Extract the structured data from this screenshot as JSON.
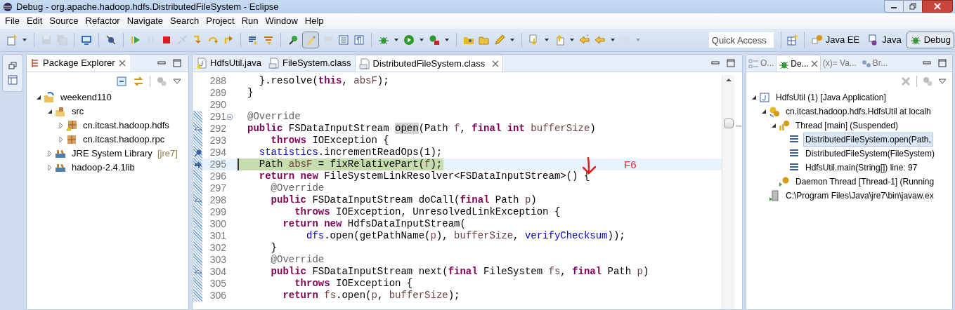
{
  "window": {
    "title": "Debug - org.apache.hadoop.hdfs.DistributedFileSystem - Eclipse"
  },
  "menu": [
    "File",
    "Edit",
    "Source",
    "Refactor",
    "Navigate",
    "Search",
    "Project",
    "Run",
    "Window",
    "Help"
  ],
  "toolbar": [
    {
      "kind": "new",
      "pressed": false,
      "disabled": false
    },
    {
      "kind": "caret",
      "pressed": false,
      "disabled": false
    },
    {
      "kind": "separator"
    },
    {
      "kind": "save",
      "pressed": false,
      "disabled": true
    },
    {
      "kind": "save-all",
      "pressed": false,
      "disabled": true
    },
    {
      "kind": "separator"
    },
    {
      "kind": "console",
      "pressed": false,
      "disabled": false
    },
    {
      "kind": "separator"
    },
    {
      "kind": "skip-breakpoints",
      "pressed": false,
      "disabled": false
    },
    {
      "kind": "separator"
    },
    {
      "kind": "resume",
      "pressed": false,
      "disabled": false
    },
    {
      "kind": "suspend",
      "pressed": false,
      "disabled": true
    },
    {
      "kind": "terminate",
      "pressed": false,
      "disabled": false
    },
    {
      "kind": "disconnect",
      "pressed": false,
      "disabled": true
    },
    {
      "kind": "step-into",
      "pressed": false,
      "disabled": false
    },
    {
      "kind": "step-over",
      "pressed": false,
      "disabled": false
    },
    {
      "kind": "step-return",
      "pressed": false,
      "disabled": false
    },
    {
      "kind": "separator"
    },
    {
      "kind": "drop-frame",
      "pressed": false,
      "disabled": false
    },
    {
      "kind": "step-filters",
      "pressed": false,
      "disabled": false
    },
    {
      "kind": "separator"
    },
    {
      "kind": "breakpoint-toggle",
      "pressed": false,
      "disabled": false
    },
    {
      "kind": "highlight",
      "pressed": true,
      "disabled": false
    },
    {
      "kind": "comment",
      "pressed": false,
      "disabled": true
    },
    {
      "kind": "block",
      "pressed": false,
      "disabled": false
    },
    {
      "kind": "whitespace",
      "pressed": false,
      "disabled": false
    },
    {
      "kind": "separator"
    },
    {
      "kind": "debug",
      "pressed": false,
      "disabled": false
    },
    {
      "kind": "caret",
      "pressed": false,
      "disabled": false
    },
    {
      "kind": "run",
      "pressed": false,
      "disabled": false
    },
    {
      "kind": "caret",
      "pressed": false,
      "disabled": false
    },
    {
      "kind": "external-tools",
      "pressed": false,
      "disabled": false
    },
    {
      "kind": "caret",
      "pressed": false,
      "disabled": false
    },
    {
      "kind": "separator"
    },
    {
      "kind": "open-type",
      "pressed": false,
      "disabled": false
    },
    {
      "kind": "open-folder",
      "pressed": false,
      "disabled": false
    },
    {
      "kind": "pencil",
      "pressed": false,
      "disabled": false
    },
    {
      "kind": "caret",
      "pressed": false,
      "disabled": false
    },
    {
      "kind": "separator"
    },
    {
      "kind": "next-annotation",
      "pressed": false,
      "disabled": false
    },
    {
      "kind": "caret",
      "pressed": false,
      "disabled": false
    },
    {
      "kind": "prev-annotation",
      "pressed": false,
      "disabled": false
    },
    {
      "kind": "caret",
      "pressed": false,
      "disabled": false
    },
    {
      "kind": "back",
      "pressed": false,
      "disabled": false
    },
    {
      "kind": "back-arrow",
      "pressed": false,
      "disabled": false
    },
    {
      "kind": "caret",
      "pressed": false,
      "disabled": false
    },
    {
      "kind": "forward",
      "pressed": false,
      "disabled": true
    },
    {
      "kind": "caret",
      "pressed": false,
      "disabled": true
    }
  ],
  "quick_access": {
    "placeholder": "Quick Access"
  },
  "perspectives": [
    {
      "label": "Java EE",
      "kind": "javaee",
      "selected": false
    },
    {
      "label": "Java",
      "kind": "java",
      "selected": false
    },
    {
      "label": "Debug",
      "kind": "debug",
      "selected": true
    }
  ],
  "package_explorer": {
    "title": "Package Explorer",
    "items": [
      {
        "label": "weekend110",
        "kind": "project",
        "expanded": true,
        "selected": false,
        "children": [
          {
            "label": "src",
            "kind": "source-folder",
            "expanded": true,
            "selected": false,
            "children": [
              {
                "label": "cn.itcast.hadoop.hdfs",
                "kind": "package-warning",
                "expanded": false,
                "selected": false
              },
              {
                "label": "cn.itcast.hadoop.rpc",
                "kind": "package",
                "expanded": false,
                "selected": false
              }
            ]
          },
          {
            "label": "JRE System Library",
            "decoration": "[jre7]",
            "kind": "library",
            "expanded": false,
            "selected": false
          },
          {
            "label": "hadoop-2.4.1lib",
            "kind": "library",
            "expanded": false,
            "selected": false
          }
        ]
      }
    ]
  },
  "editor": {
    "tabs": [
      {
        "label": "HdfsUtil.java",
        "kind": "java",
        "selected": false
      },
      {
        "label": "FileSystem.class",
        "kind": "class",
        "selected": false
      },
      {
        "label": "DistributedFileSystem.class",
        "kind": "class",
        "selected": true
      }
    ],
    "lines": [
      {
        "number": "288",
        "kind": "plain",
        "in_range": false,
        "current": false,
        "tokens": [
          {
            "kind": "plain",
            "text": "  }.resolve("
          },
          {
            "kind": "keyword",
            "text": "this"
          },
          {
            "kind": "plain",
            "text": ", "
          },
          {
            "kind": "local",
            "text": "absF"
          },
          {
            "kind": "plain",
            "text": ");"
          }
        ]
      },
      {
        "number": "289",
        "kind": "plain",
        "in_range": false,
        "current": false,
        "tokens": [
          {
            "kind": "plain",
            "text": "}"
          }
        ]
      },
      {
        "number": "290",
        "kind": "plain",
        "in_range": false,
        "current": false
      },
      {
        "number": "291",
        "in_range": true,
        "current": false,
        "kind": "fold",
        "tokens": [
          {
            "kind": "annotation",
            "text": "@Override"
          }
        ]
      },
      {
        "number": "292",
        "in_range": true,
        "current": false,
        "kind": "override",
        "tokens": [
          {
            "kind": "keyword",
            "text": "public"
          },
          {
            "kind": "plain",
            "text": " FSDataInputStream "
          },
          {
            "kind": "occurrence",
            "text": "open"
          },
          {
            "kind": "plain",
            "text": "(Path "
          },
          {
            "kind": "local",
            "text": "f"
          },
          {
            "kind": "plain",
            "text": ", "
          },
          {
            "kind": "keyword",
            "text": "final int"
          },
          {
            "kind": "local",
            "text": " bufferSize"
          },
          {
            "kind": "plain",
            "text": ")"
          }
        ]
      },
      {
        "number": "293",
        "kind": "plain",
        "in_range": true,
        "current": false,
        "tokens": [
          {
            "kind": "keyword",
            "text": "    throws"
          },
          {
            "kind": "plain",
            "text": " IOException {"
          }
        ]
      },
      {
        "number": "294",
        "in_range": true,
        "current": false,
        "kind": "breakpoint",
        "tokens": [
          {
            "kind": "field",
            "text": "  statistics"
          },
          {
            "kind": "plain",
            "text": ".incrementReadOps(1);"
          }
        ]
      },
      {
        "number": "295",
        "in_range": true,
        "current": true,
        "kind": "instruction-pointer",
        "tokens": [
          {
            "kind": "plain",
            "text": "  Path "
          },
          {
            "kind": "local",
            "text": "absF"
          },
          {
            "kind": "plain",
            "text": " = fixRelativePart("
          },
          {
            "kind": "local",
            "text": "f"
          },
          {
            "kind": "plain",
            "text": ");"
          }
        ]
      },
      {
        "number": "296",
        "kind": "plain",
        "in_range": true,
        "current": false,
        "tokens": [
          {
            "kind": "keyword",
            "text": "  return new"
          },
          {
            "kind": "plain",
            "text": " FileSystemLinkResolver<FSDataInputStream>() {"
          }
        ]
      },
      {
        "number": "297",
        "kind": "plain",
        "in_range": true,
        "current": false,
        "tokens": [
          {
            "kind": "annotation",
            "text": "    @Override"
          }
        ]
      },
      {
        "number": "298",
        "in_range": true,
        "current": false,
        "kind": "override",
        "tokens": [
          {
            "kind": "keyword",
            "text": "    public"
          },
          {
            "kind": "plain",
            "text": " FSDataInputStream doCall("
          },
          {
            "kind": "keyword",
            "text": "final"
          },
          {
            "kind": "plain",
            "text": " Path "
          },
          {
            "kind": "local",
            "text": "p"
          },
          {
            "kind": "plain",
            "text": ")"
          }
        ]
      },
      {
        "number": "299",
        "kind": "plain",
        "in_range": true,
        "current": false,
        "tokens": [
          {
            "kind": "keyword",
            "text": "        throws"
          },
          {
            "kind": "plain",
            "text": " IOException, UnresolvedLinkException {"
          }
        ]
      },
      {
        "number": "300",
        "kind": "plain",
        "in_range": true,
        "current": false,
        "tokens": [
          {
            "kind": "keyword",
            "text": "      return new"
          },
          {
            "kind": "plain",
            "text": " HdfsDataInputStream("
          }
        ]
      },
      {
        "number": "301",
        "kind": "plain",
        "in_range": true,
        "current": false,
        "tokens": [
          {
            "kind": "field",
            "text": "          dfs"
          },
          {
            "kind": "plain",
            "text": ".open(getPathName("
          },
          {
            "kind": "local",
            "text": "p"
          },
          {
            "kind": "plain",
            "text": "), "
          },
          {
            "kind": "local",
            "text": "bufferSize"
          },
          {
            "kind": "plain",
            "text": ", "
          },
          {
            "kind": "field",
            "text": "verifyChecksum"
          },
          {
            "kind": "plain",
            "text": "));"
          }
        ]
      },
      {
        "number": "302",
        "kind": "plain",
        "in_range": true,
        "current": false,
        "tokens": [
          {
            "kind": "plain",
            "text": "    }"
          }
        ]
      },
      {
        "number": "303",
        "kind": "plain",
        "in_range": true,
        "current": false,
        "tokens": [
          {
            "kind": "annotation",
            "text": "    @Override"
          }
        ]
      },
      {
        "number": "304",
        "in_range": true,
        "current": false,
        "kind": "override",
        "tokens": [
          {
            "kind": "keyword",
            "text": "    public"
          },
          {
            "kind": "plain",
            "text": " FSDataInputStream next("
          },
          {
            "kind": "keyword",
            "text": "final"
          },
          {
            "kind": "plain",
            "text": " FileSystem "
          },
          {
            "kind": "local",
            "text": "fs"
          },
          {
            "kind": "plain",
            "text": ", "
          },
          {
            "kind": "keyword",
            "text": "final"
          },
          {
            "kind": "plain",
            "text": " Path "
          },
          {
            "kind": "local",
            "text": "p"
          },
          {
            "kind": "plain",
            "text": ")"
          }
        ]
      },
      {
        "number": "305",
        "kind": "plain",
        "in_range": true,
        "current": false,
        "tokens": [
          {
            "kind": "keyword",
            "text": "        throws"
          },
          {
            "kind": "plain",
            "text": " IOException {"
          }
        ]
      },
      {
        "number": "306",
        "kind": "plain",
        "in_range": true,
        "current": false,
        "tokens": [
          {
            "kind": "keyword",
            "text": "      return"
          },
          {
            "kind": "local",
            "text": " fs"
          },
          {
            "kind": "plain",
            "text": ".open("
          },
          {
            "kind": "local",
            "text": "p"
          },
          {
            "kind": "plain",
            "text": ", "
          },
          {
            "kind": "local",
            "text": "bufferSize"
          },
          {
            "kind": "plain",
            "text": ");"
          }
        ]
      }
    ],
    "note": {
      "text": "F6"
    }
  },
  "debug_view": {
    "tabs": [
      {
        "label": "O...",
        "kind": "outline",
        "selected": false
      },
      {
        "label": "De...",
        "kind": "debug",
        "selected": true
      },
      {
        "label": "(x)= Va...",
        "kind": "variables",
        "selected": false
      },
      {
        "label": "Br...",
        "kind": "breakpoints",
        "selected": false
      }
    ],
    "items": [
      {
        "label": "HdfsUtil (1) [Java Application]",
        "kind": "launch",
        "expanded": true,
        "selected": false,
        "children": [
          {
            "label": "cn.itcast.hadoop.hdfs.HdfsUtil at localh",
            "kind": "target",
            "expanded": true,
            "selected": false,
            "children": [
              {
                "label": "Thread [main] (Suspended)",
                "kind": "thread-suspended",
                "expanded": true,
                "selected": false,
                "children": [
                  {
                    "label": "DistributedFileSystem.open(Path,",
                    "kind": "frame",
                    "selected": true
                  },
                  {
                    "label": "DistributedFileSystem(FileSystem)",
                    "kind": "frame",
                    "selected": false
                  },
                  {
                    "label": "HdfsUtil.main(String[]) line: 97",
                    "kind": "frame",
                    "selected": false
                  }
                ]
              },
              {
                "label": "Daemon Thread [Thread-1] (Running",
                "kind": "thread-running",
                "selected": false
              }
            ]
          },
          {
            "label": "C:\\Program Files\\Java\\jre7\\bin\\javaw.ex",
            "kind": "process",
            "selected": false
          }
        ]
      }
    ]
  }
}
